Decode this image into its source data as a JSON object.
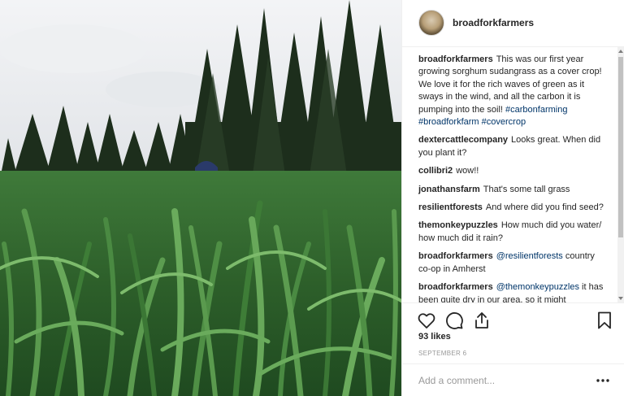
{
  "post": {
    "username": "broadforkfarmers",
    "photo_alt": "Person standing in a field of tall sorghum sudangrass with evergreen trees behind",
    "caption": {
      "user": "broadforkfarmers",
      "text": "This was our first year growing sorghum sudangrass as a cover crop! We love it for the rich waves of green as it sways in the wind, and all the carbon it is pumping into the soil!",
      "hashtags": [
        "#carbonfarming",
        "#broadforkfarm",
        "#covercrop"
      ]
    },
    "comments": [
      {
        "user": "dextercattlecompany",
        "text": "Looks great. When did you plant it?"
      },
      {
        "user": "collibri2",
        "text": "wow!!"
      },
      {
        "user": "jonathansfarm",
        "text": "That's some tall grass"
      },
      {
        "user": "resilientforests",
        "text": "And where did you find seed?"
      },
      {
        "user": "themonkeypuzzles",
        "text": "How much did you water/ how much did it rain?"
      },
      {
        "user": "broadforkfarmers",
        "mention": "@resilientforests",
        "text": "country co-op in Amherst"
      },
      {
        "user": "broadforkfarmers",
        "mention": "@themonkeypuzzles",
        "text": "it has been quite dry in our area, so it might"
      }
    ],
    "likes": "93 likes",
    "date": "SEPTEMBER 6",
    "comment_placeholder": "Add a comment...",
    "more_label": "•••"
  },
  "icons": {
    "like": "heart-icon",
    "comment": "comment-icon",
    "share": "share-icon",
    "save": "bookmark-icon",
    "more": "more-options-icon"
  },
  "colors": {
    "hashtag": "#003569",
    "muted": "#999999",
    "text": "#262626",
    "divider": "#efefef"
  }
}
